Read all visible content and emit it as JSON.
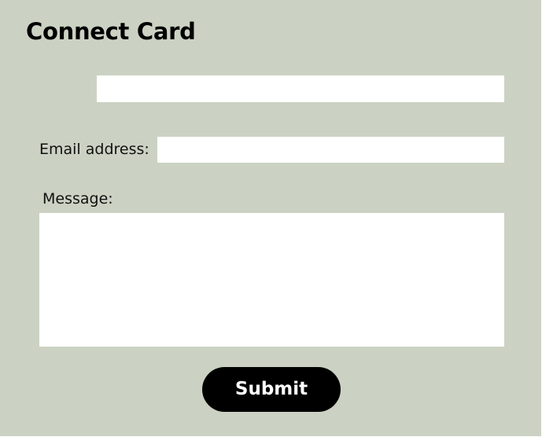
{
  "form": {
    "title": "Connect Card",
    "name_field": {
      "value": "",
      "placeholder": ""
    },
    "email_field": {
      "label": "Email address:",
      "value": "",
      "placeholder": ""
    },
    "message_field": {
      "label": "Message:",
      "value": "",
      "placeholder": ""
    },
    "submit_label": "Submit"
  },
  "colors": {
    "background": "#cbd2c3",
    "field_background": "#ffffff",
    "button_background": "#000000",
    "button_text": "#ffffff",
    "text": "#000000"
  }
}
